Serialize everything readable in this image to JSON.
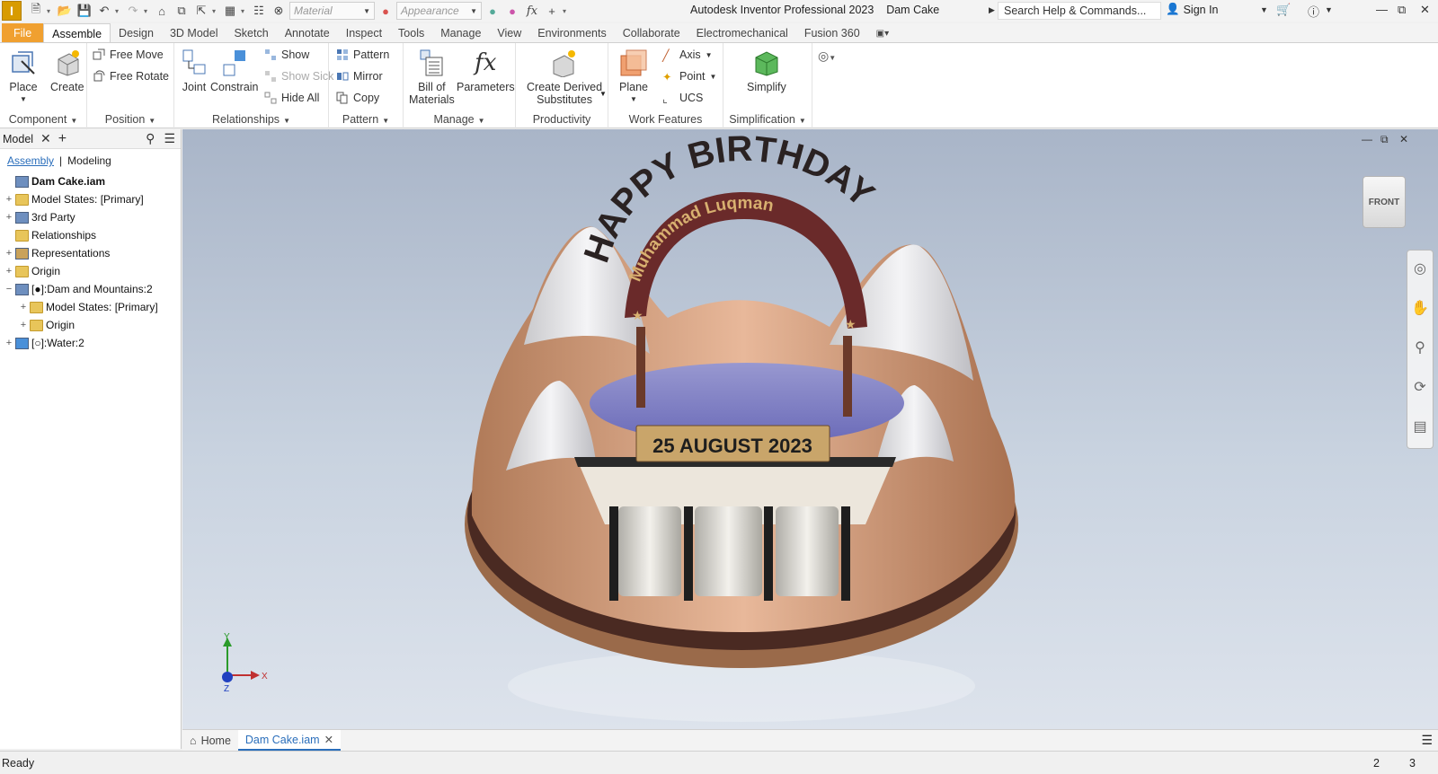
{
  "app": {
    "title": "Autodesk Inventor Professional 2023",
    "document": "Dam Cake",
    "logo": "I"
  },
  "quick_access": {
    "material_placeholder": "Material",
    "appearance_placeholder": "Appearance",
    "fx_label": "fx"
  },
  "search": {
    "placeholder": "Search Help & Commands..."
  },
  "signin_label": "Sign In",
  "tabs": [
    "File",
    "Assemble",
    "Design",
    "3D Model",
    "Sketch",
    "Annotate",
    "Inspect",
    "Tools",
    "Manage",
    "View",
    "Environments",
    "Collaborate",
    "Electromechanical",
    "Fusion 360"
  ],
  "active_tab": "Assemble",
  "ribbon": {
    "component": {
      "label": "Component",
      "place": "Place",
      "create": "Create"
    },
    "position": {
      "label": "Position",
      "free_move": "Free Move",
      "free_rotate": "Free Rotate"
    },
    "relationships": {
      "label": "Relationships",
      "joint": "Joint",
      "constrain": "Constrain",
      "show": "Show",
      "show_sick": "Show Sick",
      "hide_all": "Hide All"
    },
    "pattern": {
      "label": "Pattern",
      "pattern": "Pattern",
      "mirror": "Mirror",
      "copy": "Copy"
    },
    "manage": {
      "label": "Manage",
      "bom_line1": "Bill of",
      "bom_line2": "Materials",
      "parameters": "Parameters",
      "fx": "fx"
    },
    "productivity": {
      "label": "Productivity",
      "derived_line1": "Create Derived",
      "derived_line2": "Substitutes"
    },
    "work_features": {
      "label": "Work Features",
      "plane": "Plane",
      "axis": "Axis",
      "point": "Point",
      "ucs": "UCS"
    },
    "simplification": {
      "label": "Simplification",
      "simplify": "Simplify"
    }
  },
  "browser": {
    "tab_label": "Model",
    "subtabs": [
      "Assembly",
      "Modeling"
    ],
    "tree": [
      {
        "label": "Dam Cake.iam",
        "level": 0,
        "expander": "",
        "icon": "assembly"
      },
      {
        "label": "Model States: [Primary]",
        "level": 0,
        "expander": "+",
        "icon": "folder"
      },
      {
        "label": "3rd Party",
        "level": 0,
        "expander": "+",
        "icon": "thirdparty"
      },
      {
        "label": "Relationships",
        "level": 0,
        "expander": "",
        "icon": "folder"
      },
      {
        "label": "Representations",
        "level": 0,
        "expander": "+",
        "icon": "representations"
      },
      {
        "label": "Origin",
        "level": 0,
        "expander": "+",
        "icon": "folder"
      },
      {
        "label": "[●]:Dam and Mountains:2",
        "level": 0,
        "expander": "−",
        "icon": "subassembly"
      },
      {
        "label": "Model States: [Primary]",
        "level": 1,
        "expander": "+",
        "icon": "folder"
      },
      {
        "label": "Origin",
        "level": 1,
        "expander": "+",
        "icon": "folder"
      },
      {
        "label": "[○]:Water:2",
        "level": 0,
        "expander": "+",
        "icon": "part"
      }
    ]
  },
  "model": {
    "arch_text": "HAPPY BIRTHDAY",
    "name_text": "Muhammad Luqman",
    "date_text": "25 AUGUST 2023"
  },
  "viewcube_label": "FRONT",
  "triad": {
    "x": "X",
    "y": "Y",
    "z": "Z"
  },
  "doc_tabs": [
    {
      "label": "Home"
    },
    {
      "label": "Dam Cake.iam"
    }
  ],
  "status": {
    "text": "Ready",
    "count1": "2",
    "count2": "3"
  }
}
